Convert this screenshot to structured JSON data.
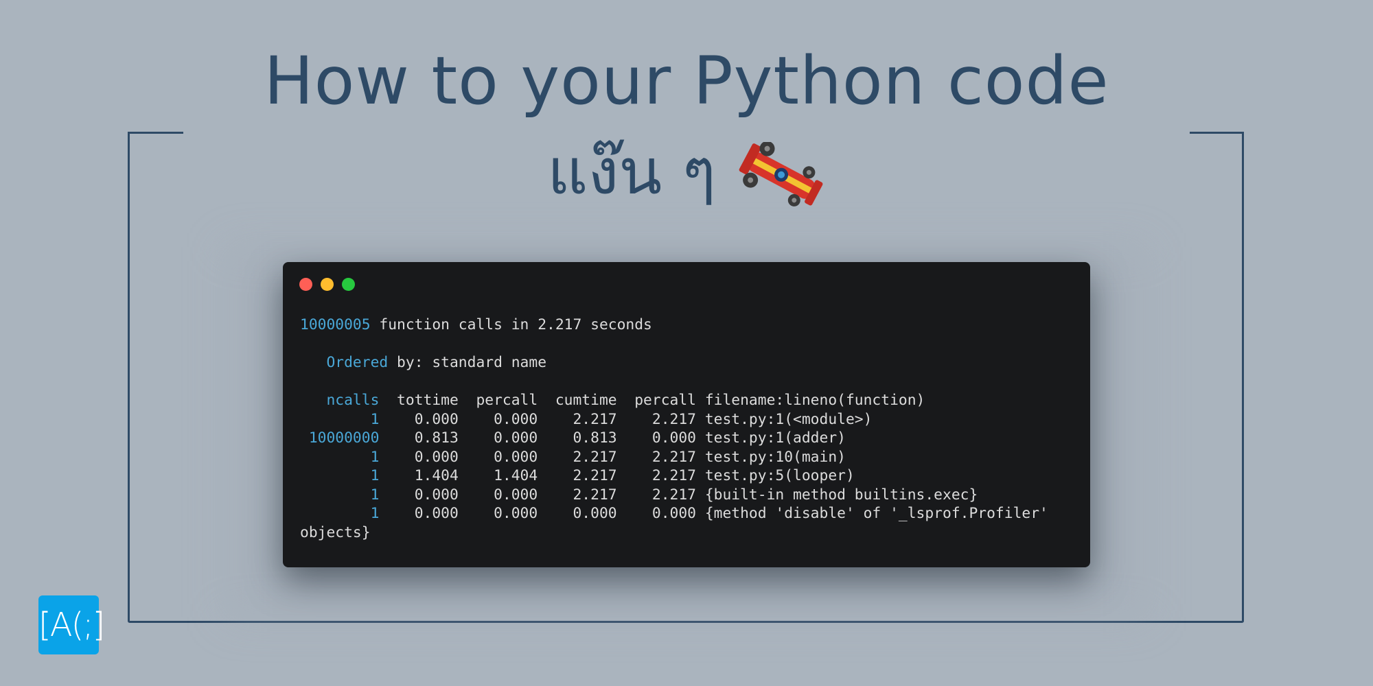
{
  "title": {
    "line1": "How to your Python code",
    "line2": "แง๊น ๆ"
  },
  "icons": {
    "title_emoji": "racing-car-icon",
    "logo": "ac-logo-icon"
  },
  "terminal": {
    "window_controls": [
      "close",
      "minimize",
      "maximize"
    ],
    "summary_count": "10000005",
    "summary_text": " function calls in 2.217 seconds",
    "ordered_label": "Ordered",
    "ordered_rest": " by: standard name",
    "header": {
      "ncalls": "ncalls",
      "rest": "  tottime  percall  cumtime  percall filename:lineno(function)"
    },
    "rows": [
      {
        "ncalls": "1",
        "tottime": "0.000",
        "percall1": "0.000",
        "cumtime": "2.217",
        "percall2": "2.217",
        "func": "test.py:1(<module>)"
      },
      {
        "ncalls": "10000000",
        "tottime": "0.813",
        "percall1": "0.000",
        "cumtime": "0.813",
        "percall2": "0.000",
        "func": "test.py:1(adder)"
      },
      {
        "ncalls": "1",
        "tottime": "0.000",
        "percall1": "0.000",
        "cumtime": "2.217",
        "percall2": "2.217",
        "func": "test.py:10(main)"
      },
      {
        "ncalls": "1",
        "tottime": "1.404",
        "percall1": "1.404",
        "cumtime": "2.217",
        "percall2": "2.217",
        "func": "test.py:5(looper)"
      },
      {
        "ncalls": "1",
        "tottime": "0.000",
        "percall1": "0.000",
        "cumtime": "2.217",
        "percall2": "2.217",
        "func": "{built-in method builtins.exec}"
      },
      {
        "ncalls": "1",
        "tottime": "0.000",
        "percall1": "0.000",
        "cumtime": "0.000",
        "percall2": "0.000",
        "func": "{method 'disable' of '_lsprof.Profiler'"
      }
    ],
    "wrap_line": "objects}"
  },
  "logo_text": "[A(;]",
  "colors": {
    "background": "#aab4be",
    "frame": "#2e4a66",
    "terminal_bg": "#18191b",
    "code_text": "#dcdcdc",
    "code_highlight": "#4aa8d8",
    "logo_bg": "#0aa3e8"
  }
}
